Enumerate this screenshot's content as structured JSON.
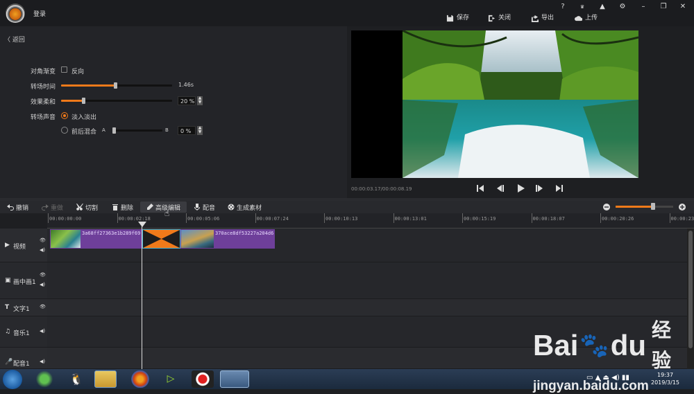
{
  "titlebar": {
    "login_label": "登录",
    "window_controls": [
      "?",
      "VIP",
      "bell",
      "gear",
      "minimize",
      "maximize",
      "close"
    ],
    "actions": [
      {
        "label": "保存",
        "icon": "save-icon"
      },
      {
        "label": "关闭",
        "icon": "exit-icon"
      },
      {
        "label": "导出",
        "icon": "export-icon"
      },
      {
        "label": "上传",
        "icon": "upload-icon"
      }
    ]
  },
  "settings": {
    "back_label": "返回",
    "diagonal_label": "对角渐变",
    "reverse_label": "反向",
    "duration_label": "转场时间",
    "duration_value": "1.46s",
    "duration_fraction": 0.49,
    "softness_label": "效果柔和",
    "softness_value": "20 %",
    "softness_fraction": 0.2,
    "sound_label": "转场声音",
    "fade_label": "淡入淡出",
    "mix_label": "前后混合",
    "mix_a": "A",
    "mix_b": "B",
    "mix_value": "0 %",
    "mix_fraction": 0.0
  },
  "preview": {
    "timecode": "00:00:03.17/00:00:08.19"
  },
  "toolbar": {
    "undo": "撤销",
    "redo": "重做",
    "cut": "切割",
    "delete": "删除",
    "advanced": "高级编辑",
    "dub": "配音",
    "generate": "生成素材",
    "zoom_fraction": 0.65
  },
  "ruler": {
    "labels": [
      "00:00:00:00",
      "00:00:02:18",
      "00:00:05:06",
      "00:00:07:24",
      "00:00:10:13",
      "00:00:13:01",
      "00:00:15:19",
      "00:00:18:07",
      "00:00:20:26",
      "00:00:23:"
    ]
  },
  "tracks": {
    "video": "视频",
    "pip": "画中画1",
    "text": "文字1",
    "music": "音乐1",
    "voice": "配音1",
    "clip1_name": "3a68ff27363e1b289f69",
    "clip2_name": "370ace8df53227a204d6"
  },
  "taskbar": {
    "time": "19:37",
    "date": "2019/3/15"
  },
  "watermark": {
    "brand": "Bai",
    "brand2": "du",
    "cn": "经验",
    "url": "jingyan.baidu.com"
  }
}
